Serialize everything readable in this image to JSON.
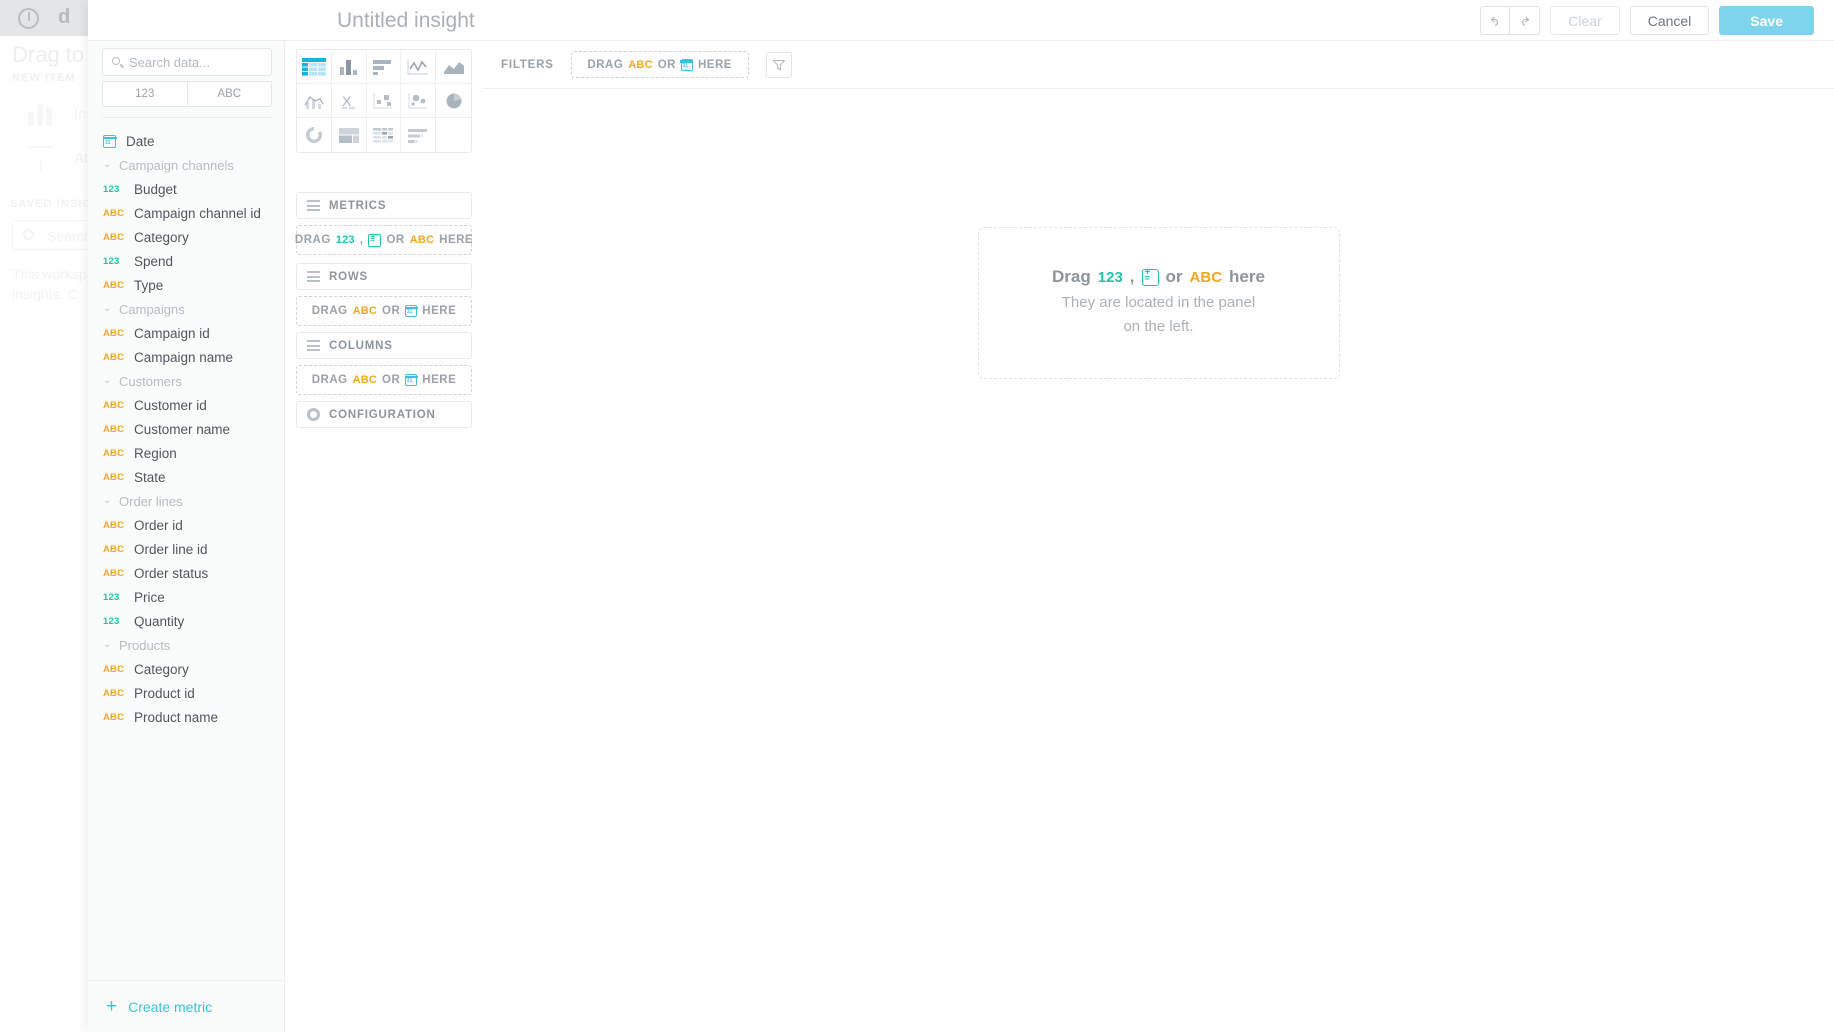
{
  "background": {
    "brand": "d",
    "title": "Drag to ac",
    "section_label": "NEW ITEM",
    "items": [
      {
        "label": "Insight",
        "icon": "bar-chart-icon"
      },
      {
        "label": "Attribu",
        "icon": "funnel-icon"
      }
    ],
    "saved_label": "SAVED INSIGH",
    "search_placeholder": "Search",
    "paragraph": "This workspa",
    "paragraph2": "insights. C",
    "paragraph_link": "Cr"
  },
  "header": {
    "title": "Untitled insight",
    "undo_icon": "undo-icon",
    "redo_icon": "redo-icon",
    "clear_label": "Clear",
    "cancel_label": "Cancel",
    "save_label": "Save",
    "save_color": "#7fd4ed"
  },
  "catalog": {
    "search_placeholder": "Search data...",
    "search_value": "",
    "search_icon": "search-icon",
    "toggle": [
      {
        "label": "123",
        "selected": false
      },
      {
        "label": "ABC",
        "selected": false
      }
    ],
    "date_field": {
      "label": "Date",
      "icon": "calendar-icon"
    },
    "groups": [
      {
        "label": "Campaign channels",
        "expanded": true,
        "fields": [
          {
            "label": "Budget",
            "type": "123"
          },
          {
            "label": "Campaign channel id",
            "type": "ABC"
          },
          {
            "label": "Category",
            "type": "ABC"
          },
          {
            "label": "Spend",
            "type": "123"
          },
          {
            "label": "Type",
            "type": "ABC"
          }
        ]
      },
      {
        "label": "Campaigns",
        "expanded": true,
        "fields": [
          {
            "label": "Campaign id",
            "type": "ABC"
          },
          {
            "label": "Campaign name",
            "type": "ABC"
          }
        ]
      },
      {
        "label": "Customers",
        "expanded": true,
        "fields": [
          {
            "label": "Customer id",
            "type": "ABC"
          },
          {
            "label": "Customer name",
            "type": "ABC"
          },
          {
            "label": "Region",
            "type": "ABC"
          },
          {
            "label": "State",
            "type": "ABC"
          }
        ]
      },
      {
        "label": "Order lines",
        "expanded": true,
        "fields": [
          {
            "label": "Order id",
            "type": "ABC"
          },
          {
            "label": "Order line id",
            "type": "ABC"
          },
          {
            "label": "Order status",
            "type": "ABC"
          },
          {
            "label": "Price",
            "type": "123"
          },
          {
            "label": "Quantity",
            "type": "123"
          }
        ]
      },
      {
        "label": "Products",
        "expanded": true,
        "fields": [
          {
            "label": "Category",
            "type": "ABC"
          },
          {
            "label": "Product id",
            "type": "ABC"
          },
          {
            "label": "Product name",
            "type": "ABC"
          }
        ]
      }
    ],
    "create_metric_label": "Create metric",
    "create_metric_icon": "plus-icon"
  },
  "visualizations": [
    {
      "name": "table-chart",
      "selected": true
    },
    {
      "name": "column-chart",
      "selected": false
    },
    {
      "name": "bar-chart",
      "selected": false
    },
    {
      "name": "line-chart",
      "selected": false
    },
    {
      "name": "area-chart",
      "selected": false
    },
    {
      "name": "combo-chart",
      "selected": false
    },
    {
      "name": "scatter-chart",
      "selected": false
    },
    {
      "name": "bubble-chart",
      "selected": false
    },
    {
      "name": "heatmap-chart",
      "selected": false
    },
    {
      "name": "pie-chart",
      "selected": false
    },
    {
      "name": "donut-chart",
      "selected": false
    },
    {
      "name": "treemap-chart",
      "selected": false
    },
    {
      "name": "pivot-table",
      "selected": false
    },
    {
      "name": "headline-list",
      "selected": false
    },
    {
      "name": "empty-slot",
      "selected": false
    }
  ],
  "buckets": {
    "metrics": {
      "label": "METRICS",
      "icon": "list-icon",
      "drop": {
        "drag": "DRAG",
        "num": "123",
        "comma": ",",
        "or": "OR",
        "txt": "ABC",
        "here": "HERE",
        "metric_icon": "metric-icon"
      }
    },
    "rows": {
      "label": "ROWS",
      "icon": "list-icon",
      "drop": {
        "drag": "DRAG",
        "txt": "ABC",
        "or": "OR",
        "here": "HERE",
        "cal_icon": "calendar-icon"
      }
    },
    "columns": {
      "label": "COLUMNS",
      "icon": "list-icon",
      "drop": {
        "drag": "DRAG",
        "txt": "ABC",
        "or": "OR",
        "here": "HERE",
        "cal_icon": "calendar-icon"
      }
    },
    "configuration": {
      "label": "CONFIGURATION",
      "icon": "gear-icon"
    }
  },
  "canvas": {
    "filters_label": "FILTERS",
    "filters_drop": {
      "drag": "DRAG",
      "txt": "ABC",
      "or": "OR",
      "here": "HERE",
      "cal_icon": "calendar-icon"
    },
    "filter_button_icon": "funnel-icon",
    "empty_state": {
      "drag": "Drag",
      "num": "123",
      "comma": ",",
      "or": "or",
      "txt": "ABC",
      "here": "here",
      "sub_line1": "They are located in the panel",
      "sub_line2": "on the left."
    }
  }
}
